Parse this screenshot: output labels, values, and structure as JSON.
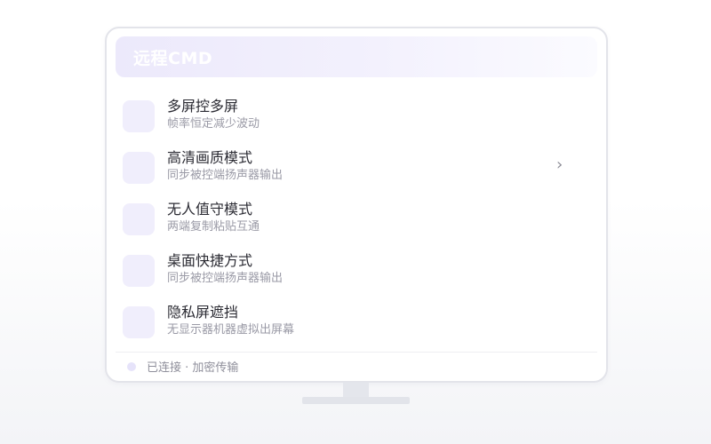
{
  "header": {
    "title": "远程CMD"
  },
  "items": [
    {
      "title": "多屏控多屏",
      "subtitle": "帧率恒定减少波动",
      "icon": "feature-icon",
      "has_chevron": false
    },
    {
      "title": "高清画质模式",
      "subtitle": "同步被控端扬声器输出",
      "icon": "feature-icon",
      "has_chevron": true,
      "chevron": "›"
    },
    {
      "title": "无人值守模式",
      "subtitle": "两端复制粘贴互通",
      "icon": "feature-icon",
      "has_chevron": false
    },
    {
      "title": "桌面快捷方式",
      "subtitle": "同步被控端扬声器输出",
      "icon": "feature-icon",
      "has_chevron": false
    },
    {
      "title": "隐私屏遮挡",
      "subtitle": "无显示器机器虚拟出屏幕",
      "icon": "feature-icon",
      "has_chevron": false
    }
  ],
  "footer": {
    "status": "已连接 · 加密传输",
    "status_icon": "status-dot-icon"
  },
  "colors": {
    "accent_light": "#f0eefc",
    "header_gradient_start": "#ece9fb",
    "frame_border": "#e3e4ea"
  }
}
